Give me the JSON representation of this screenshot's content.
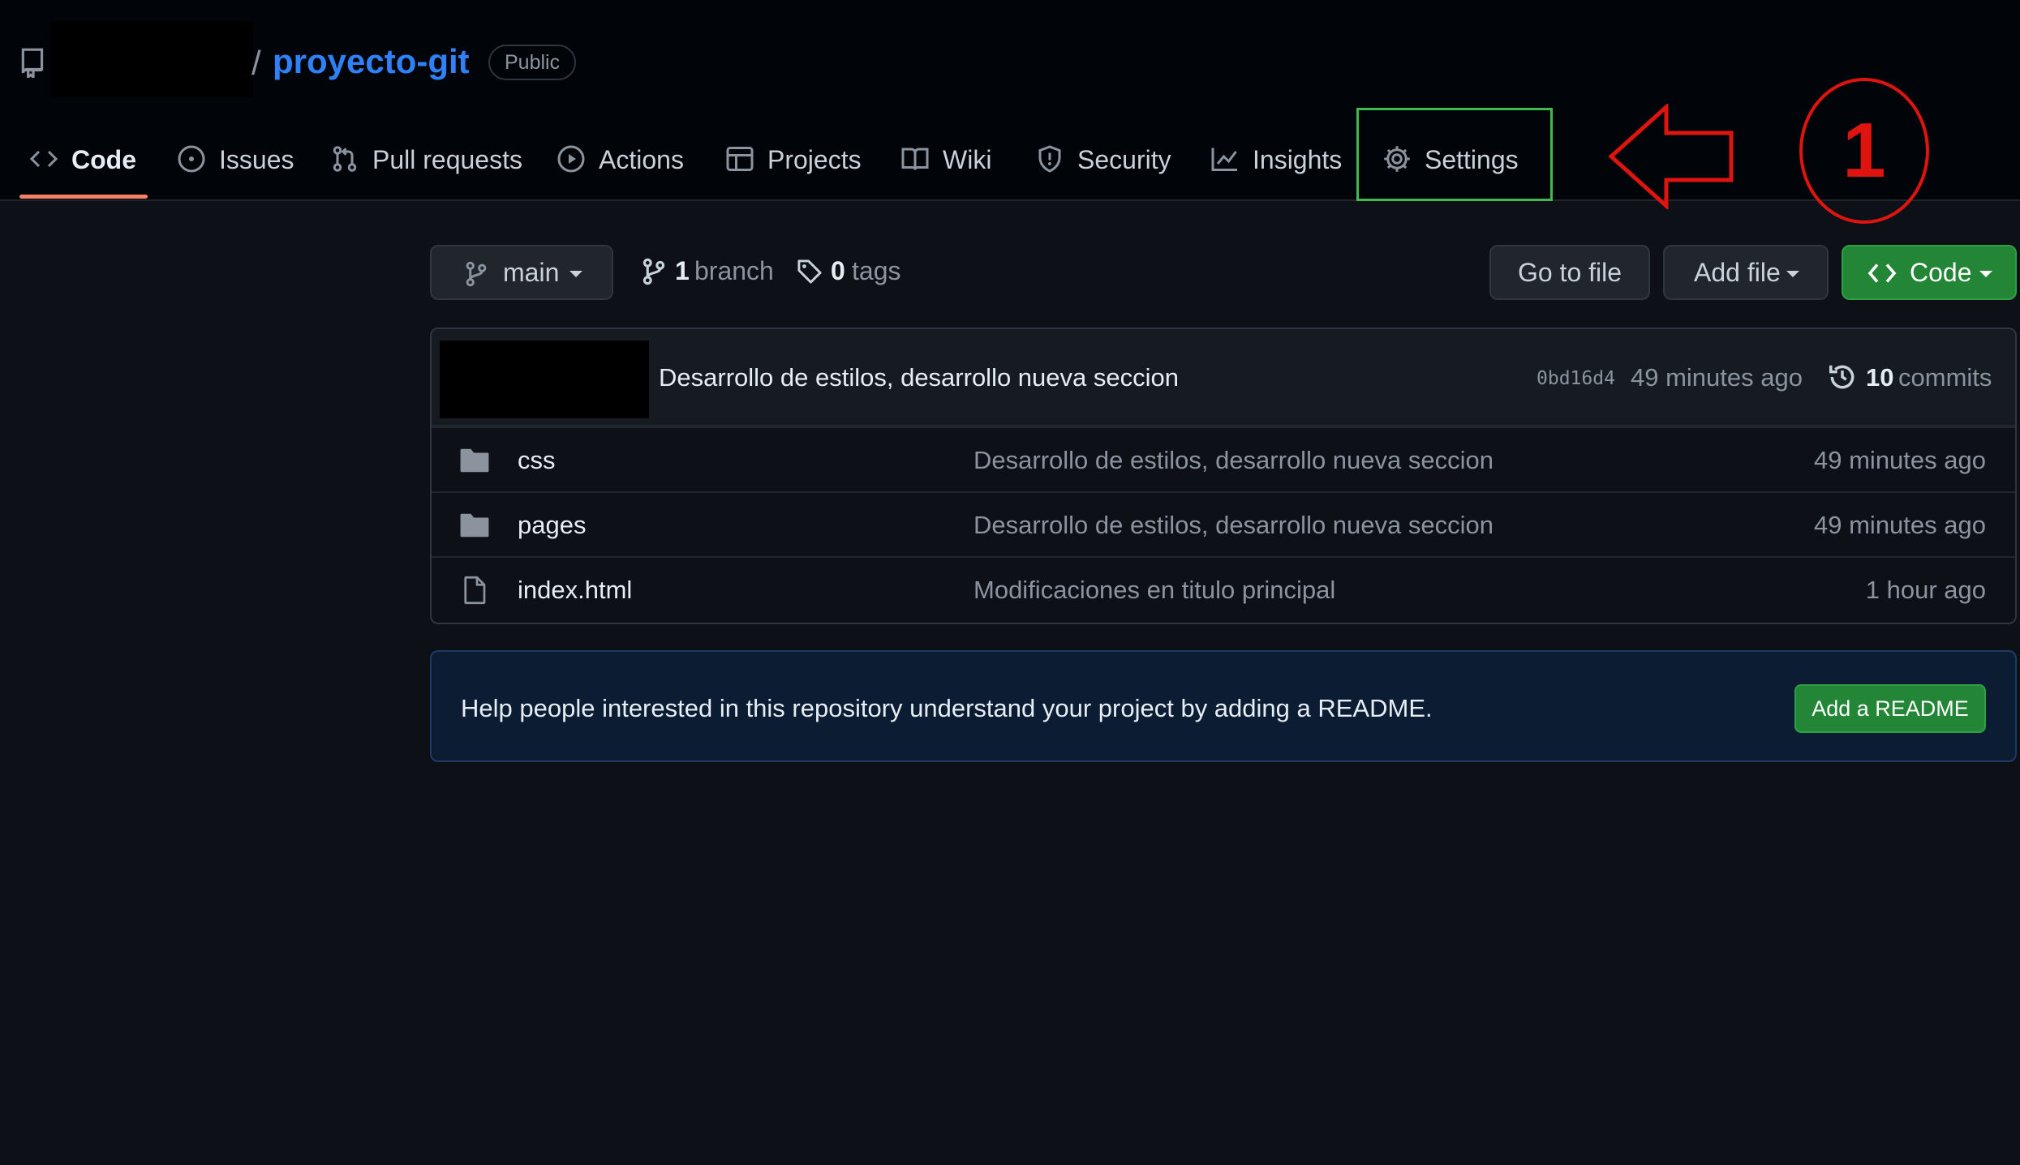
{
  "repo": {
    "slash": "/",
    "name": "proyecto-git",
    "visibility": "Public"
  },
  "tabs": [
    {
      "label": "Code",
      "icon": "code-icon",
      "selected": true
    },
    {
      "label": "Issues",
      "icon": "issue-opened-icon"
    },
    {
      "label": "Pull requests",
      "icon": "git-pull-request-icon"
    },
    {
      "label": "Actions",
      "icon": "play-icon"
    },
    {
      "label": "Projects",
      "icon": "table-icon"
    },
    {
      "label": "Wiki",
      "icon": "book-icon"
    },
    {
      "label": "Security",
      "icon": "shield-icon"
    },
    {
      "label": "Insights",
      "icon": "graph-icon"
    },
    {
      "label": "Settings",
      "icon": "gear-icon"
    }
  ],
  "annotation": {
    "step_number": "1",
    "color": "#e0140f",
    "highlight_color": "#3fb950"
  },
  "toolbar": {
    "branch": "main",
    "branch_count": "1",
    "branch_word": "branch",
    "tag_count": "0",
    "tag_word": "tags",
    "goto_file": "Go to file",
    "add_file": "Add file",
    "code": "Code"
  },
  "latest_commit": {
    "message": "Desarrollo de estilos, desarrollo nueva seccion",
    "sha": "0bd16d4",
    "time": "49 minutes ago",
    "commit_count": "10",
    "commit_word": "commits"
  },
  "files": [
    {
      "type": "folder",
      "name": "css",
      "message": "Desarrollo de estilos, desarrollo nueva seccion",
      "age": "49 minutes ago"
    },
    {
      "type": "folder",
      "name": "pages",
      "message": "Desarrollo de estilos, desarrollo nueva seccion",
      "age": "49 minutes ago"
    },
    {
      "type": "file",
      "name": "index.html",
      "message": "Modificaciones en titulo principal",
      "age": "1 hour ago"
    }
  ],
  "readme": {
    "text": "Help people interested in this repository understand your project by adding a README.",
    "button": "Add a README"
  },
  "colors": {
    "background": "#0d1117",
    "header": "#010409",
    "link": "#2f81f7",
    "primary_button": "#238636",
    "tab_underline": "#f78166"
  }
}
